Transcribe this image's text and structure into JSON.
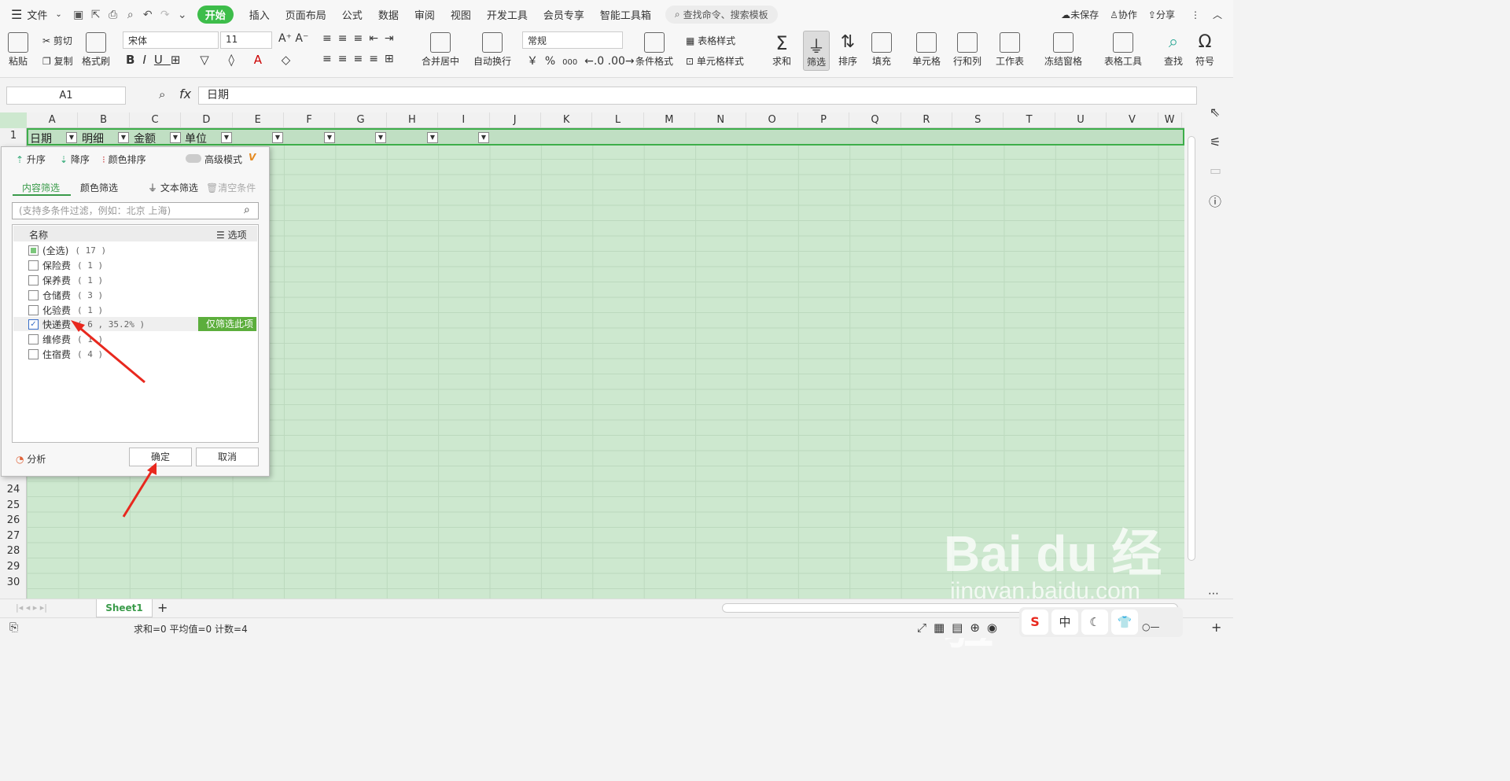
{
  "menubar": {
    "file": "文件",
    "tabs": [
      "开始",
      "插入",
      "页面布局",
      "公式",
      "数据",
      "审阅",
      "视图",
      "开发工具",
      "会员专享",
      "智能工具箱"
    ],
    "search": "查找命令、搜索模板",
    "unsaved": "未保存",
    "collab": "协作",
    "share": "分享"
  },
  "ribbon": {
    "paste": "粘贴",
    "cut": "剪切",
    "copy": "复制",
    "format_painter": "格式刷",
    "font": "宋体",
    "size": "11",
    "merge": "合并居中",
    "wrap": "自动换行",
    "numfmt": "常规",
    "currency": "￥",
    "percent": "%",
    "thousand": "000",
    "cond_format": "条件格式",
    "table_style": "表格样式",
    "cell_style": "单元格样式",
    "sum": "求和",
    "filter": "筛选",
    "sort": "排序",
    "fill": "填充",
    "cell": "单元格",
    "rowcol": "行和列",
    "sheet": "工作表",
    "freeze": "冻结窗格",
    "table_tools": "表格工具",
    "find": "查找",
    "symbol": "符号"
  },
  "formula": {
    "cellref": "A1",
    "fx": "fx",
    "value": "日期"
  },
  "columns": [
    "A",
    "B",
    "C",
    "D",
    "E",
    "F",
    "G",
    "H",
    "I",
    "J",
    "K",
    "L",
    "M",
    "N",
    "O",
    "P",
    "Q",
    "R",
    "S",
    "T",
    "U",
    "V",
    "W"
  ],
  "rows": [
    "1",
    "24",
    "25",
    "26",
    "27",
    "28",
    "29",
    "30"
  ],
  "headers": {
    "a": "日期",
    "b": "明细",
    "c": "金额",
    "d": "单位"
  },
  "panel": {
    "asc": "升序",
    "desc": "降序",
    "color_sort": "颜色排序",
    "advanced": "高级模式",
    "tab_content": "内容筛选",
    "tab_color": "颜色筛选",
    "text_filter": "文本筛选",
    "clear": "清空条件",
    "search_placeholder": "(支持多条件过滤，例如：北京 上海)",
    "col_name": "名称",
    "options": "选项",
    "items": [
      {
        "label": "(全选)",
        "count": "( 17 )"
      },
      {
        "label": "保险费",
        "count": "( 1 )"
      },
      {
        "label": "保养费",
        "count": "( 1 )"
      },
      {
        "label": "仓储费",
        "count": "( 3 )"
      },
      {
        "label": "化验费",
        "count": "( 1 )"
      },
      {
        "label": "快递费",
        "count": "( 6 , 35.2% )"
      },
      {
        "label": "维修费",
        "count": "( 1 )"
      },
      {
        "label": "住宿费",
        "count": "( 4 )"
      }
    ],
    "only_this": "仅筛选此项",
    "analyze": "分析",
    "ok": "确定",
    "cancel": "取消"
  },
  "sheet": {
    "name": "Sheet1"
  },
  "status": {
    "text": "求和=0  平均值=0  计数=4"
  },
  "watermark": {
    "brand": "Bai du 经验",
    "url": "jingyan.baidu.com"
  },
  "ime": {
    "zh": "中"
  }
}
